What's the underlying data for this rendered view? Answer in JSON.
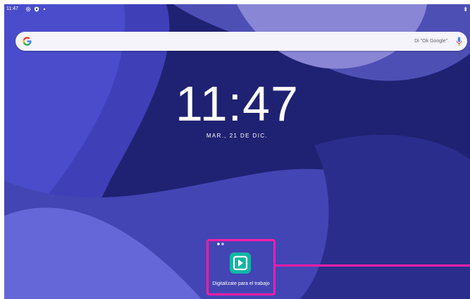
{
  "status_bar": {
    "time": "11:47",
    "icons": [
      "settings-gear-icon",
      "shield-icon",
      "notification-dot-icon"
    ],
    "right_icon": "bluetooth-icon"
  },
  "search_bar": {
    "logo": "google-g-icon",
    "hint": "Di \"Ok Google\".",
    "mic_icon": "microphone-icon"
  },
  "clock": {
    "time": "11:47",
    "date": "MAR., 21 DE DIC."
  },
  "home": {
    "page_dots": 2,
    "app": {
      "label": "Digitalízate para el trabajo",
      "icon": "play-badge-icon",
      "icon_color": "#12b5a6"
    }
  },
  "colors": {
    "wallpaper_base": "#1f2272",
    "highlight": "#ff1ea8"
  }
}
